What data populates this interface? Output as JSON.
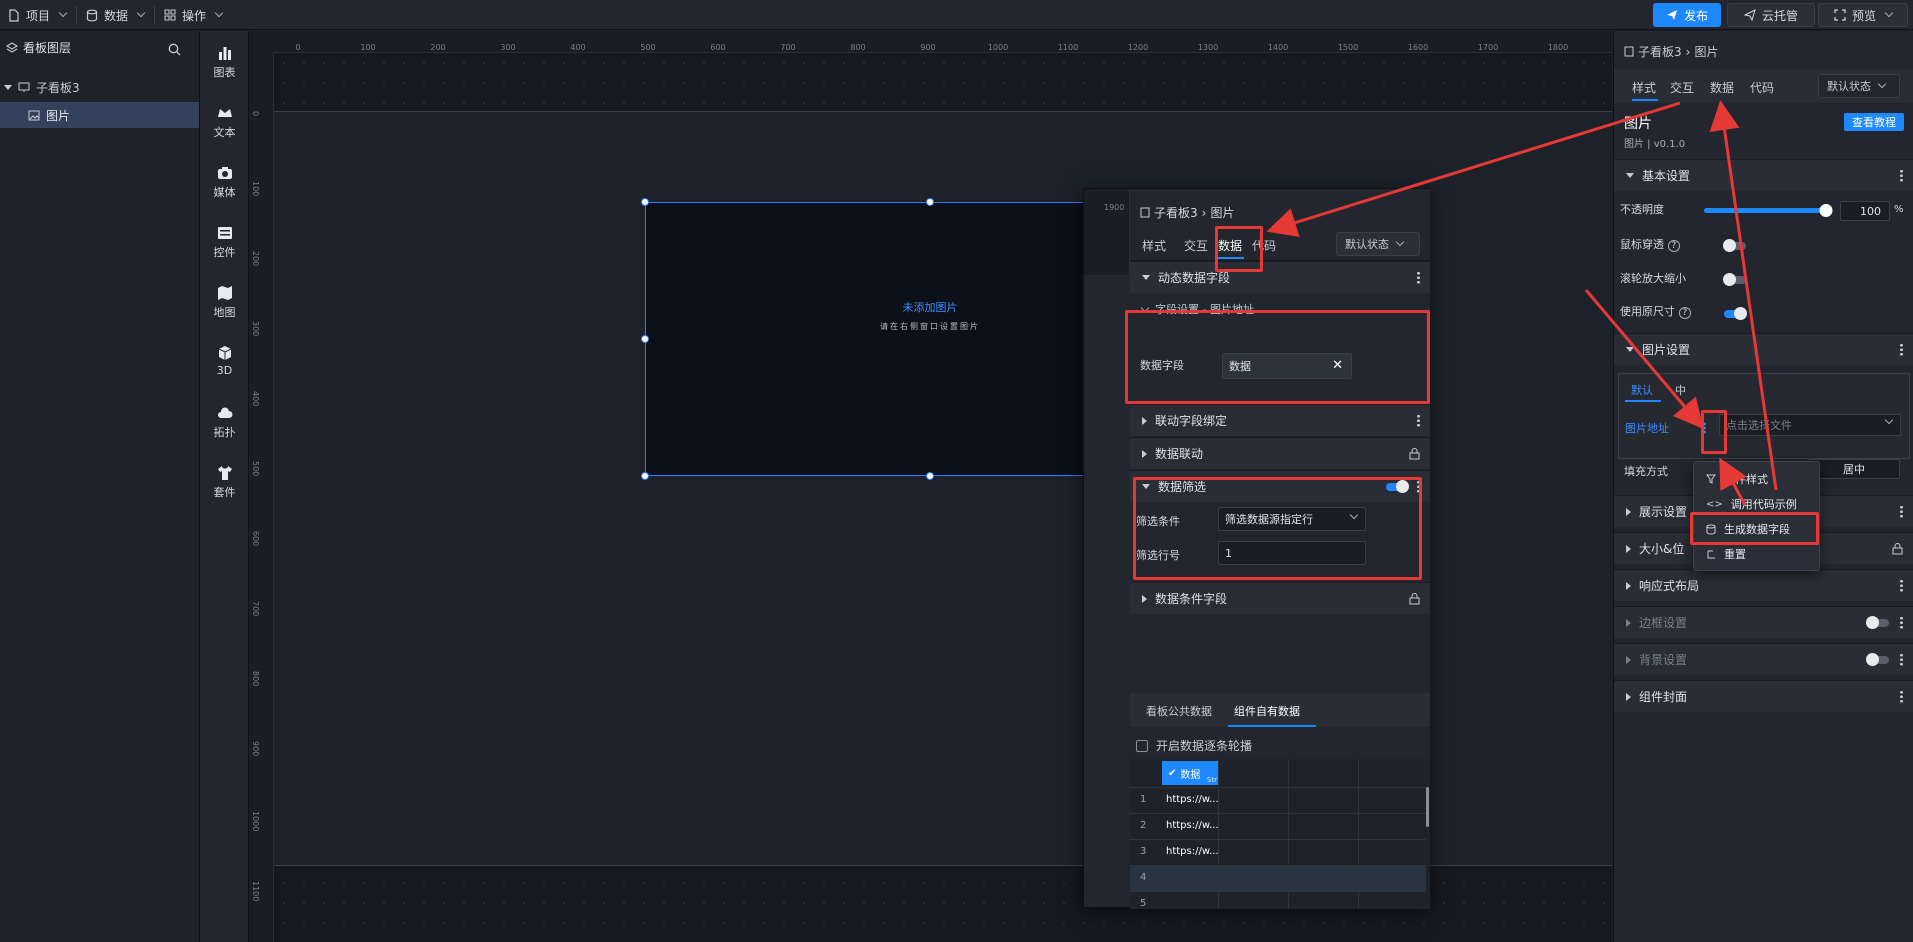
{
  "topbar": {
    "menu_project": "项目",
    "menu_data": "数据",
    "menu_ops": "操作",
    "publish": "发布",
    "cloud": "云托管",
    "preview": "预览"
  },
  "layers": {
    "title": "看板图层",
    "board": "子看板3",
    "image": "图片"
  },
  "tools": [
    "图表",
    "文本",
    "媒体",
    "控件",
    "地图",
    "3D",
    "拓扑",
    "套件"
  ],
  "ruler": {
    "h": [
      "0",
      "100",
      "200",
      "300",
      "400",
      "500",
      "600",
      "700",
      "800",
      "900",
      "1000",
      "1100",
      "1200",
      "1300",
      "1400",
      "1500",
      "1600",
      "1700",
      "1800",
      "1900"
    ],
    "v": [
      "0",
      "100",
      "200",
      "300",
      "400",
      "500",
      "600",
      "700",
      "800",
      "900",
      "1000",
      "1100"
    ]
  },
  "canvas": {
    "placeholder_title": "未添加图片",
    "placeholder_sub": "请在右侧窗口设置图片"
  },
  "float_panel": {
    "ruler_label": "1900",
    "breadcrumb_parent": "子看板3",
    "breadcrumb_child": "图片",
    "tabs": [
      "样式",
      "交互",
      "数据",
      "代码"
    ],
    "state": "默认状态",
    "sec_dynamic": "动态数据字段",
    "field_setting": "字段设置 - 图片地址",
    "data_field_label": "数据字段",
    "data_field_value": "数据",
    "sec_link_bind": "联动字段绑定",
    "sec_link": "数据联动",
    "sec_filter": "数据筛选",
    "filter_cond_label": "筛选条件",
    "filter_cond_value": "筛选数据源指定行",
    "filter_row_label": "筛选行号",
    "filter_row_value": "1",
    "sec_condition": "数据条件字段",
    "data_tab_public": "看板公共数据",
    "data_tab_own": "组件自有数据",
    "carousel": "开启数据逐条轮播",
    "col_header": "数据",
    "col_type": "Str",
    "rows": [
      {
        "n": "1",
        "v": "https://w..."
      },
      {
        "n": "2",
        "v": "https://w..."
      },
      {
        "n": "3",
        "v": "https://w..."
      },
      {
        "n": "4",
        "v": ""
      },
      {
        "n": "5",
        "v": ""
      }
    ]
  },
  "right_panel": {
    "breadcrumb_parent": "子看板3",
    "breadcrumb_child": "图片",
    "tabs": [
      "样式",
      "交互",
      "数据",
      "代码"
    ],
    "state": "默认状态",
    "comp_name": "图片",
    "comp_version": "图片 | v0.1.0",
    "tutorial": "查看教程",
    "sec_basic": "基本设置",
    "opacity_label": "不透明度",
    "opacity_value": "100",
    "opacity_unit": "%",
    "opacity_level": 1.0,
    "mouse_through": "鼠标穿透",
    "wheel_zoom": "滚轮放大缩小",
    "original_size": "使用原尺寸",
    "sec_image": "图片设置",
    "img_tab_default": "默认",
    "img_tab_hover": "中",
    "img_addr_label": "图片地址",
    "img_addr_placeholder": "点击选择文件",
    "fill_label": "填充方式",
    "fill_value": "居中",
    "sec_display": "展示设置",
    "sec_size": "大小&位",
    "sec_responsive": "响应式布局",
    "sec_border": "边框设置",
    "sec_background": "背景设置",
    "sec_cover": "组件封面",
    "menu": [
      "条件样式",
      "调用代码示例",
      "生成数据字段",
      "重置"
    ]
  },
  "colors": {
    "accent": "#1e88ff",
    "annotation": "#e53935"
  }
}
